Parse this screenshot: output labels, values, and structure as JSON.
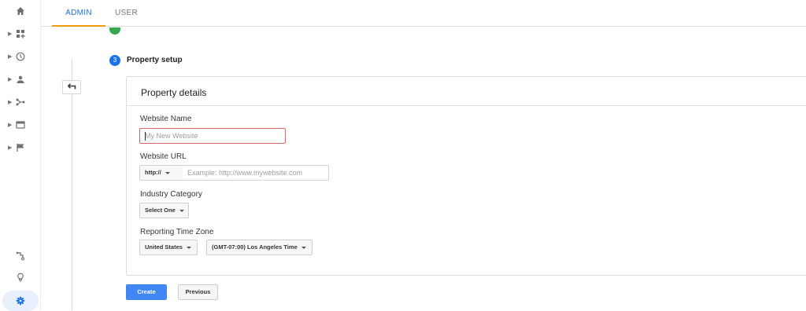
{
  "tabs": {
    "admin": "ADMIN",
    "user": "USER"
  },
  "steps": {
    "current_number": "3",
    "current_title": "Property setup"
  },
  "card": {
    "title": "Property details",
    "website_name": {
      "label": "Website Name",
      "placeholder": "My New Website"
    },
    "website_url": {
      "label": "Website URL",
      "protocol": "http://",
      "placeholder": "Example: http://www.mywebsite.com"
    },
    "industry": {
      "label": "Industry Category",
      "selected": "Select One"
    },
    "timezone": {
      "label": "Reporting Time Zone",
      "country": "United States",
      "zone": "(GMT-07:00) Los Angeles Time"
    }
  },
  "buttons": {
    "create": "Create",
    "previous": "Previous"
  },
  "colors": {
    "accent": "#1a73e8",
    "tab_underline": "#f29900",
    "error_border": "#e06666",
    "create_bg": "#4285f4",
    "step_done": "#34a853"
  },
  "sidebar_icons": [
    "home-icon",
    "customization-icon",
    "realtime-icon",
    "audience-icon",
    "acquisition-icon",
    "behavior-icon",
    "conversions-icon",
    "discover-icon",
    "lightbulb-icon",
    "admin-gear-icon"
  ]
}
